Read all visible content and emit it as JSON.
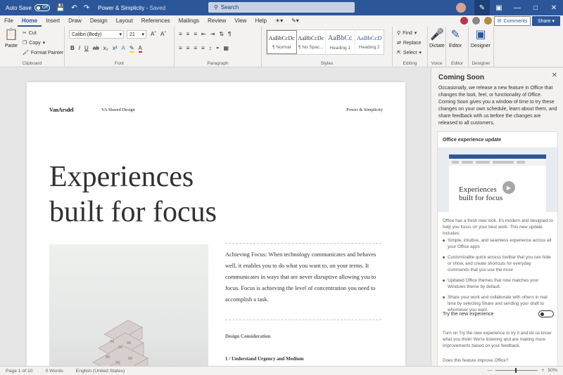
{
  "titlebar": {
    "autosave_label": "Auto Save",
    "autosave_state": "Off",
    "doc_title": "Power & Simplicity",
    "saved_status": "Saved",
    "search_placeholder": "Search"
  },
  "tabs": [
    "File",
    "Home",
    "Insert",
    "Draw",
    "Design",
    "Layout",
    "References",
    "Mailings",
    "Review",
    "View",
    "Help"
  ],
  "active_tab": "Home",
  "actions": {
    "comments": "Comments",
    "share": "Share"
  },
  "ribbon": {
    "clipboard": {
      "paste": "Paste",
      "cut": "Cut",
      "copy": "Copy",
      "format_painter": "Format Painter",
      "label": "Clipboard"
    },
    "font": {
      "family": "Calibri (Body)",
      "size": "21",
      "label": "Font"
    },
    "paragraph": {
      "label": "Paragraph"
    },
    "styles": {
      "label": "Styles",
      "items": [
        {
          "preview": "AaBbCcDc",
          "name": "¶ Normal"
        },
        {
          "preview": "AaBbCcDc",
          "name": "¶ No Spac..."
        },
        {
          "preview": "AaBbCc",
          "name": "Heading 1"
        },
        {
          "preview": "AaBbCcD",
          "name": "Heading 2"
        }
      ]
    },
    "editing": {
      "find": "Find",
      "replace": "Replace",
      "select": "Select",
      "label": "Editing"
    },
    "voice": {
      "dictate": "Dictate",
      "label": "Voice"
    },
    "editor": {
      "editor": "Editor",
      "label": "Editor"
    },
    "designer": {
      "designer": "Designer",
      "label": "Designer"
    }
  },
  "document": {
    "header_logo": "VanArsdel",
    "header_mid": "VA Shared Design",
    "header_right": "Power & Simplicity",
    "headline_line1": "Experiences",
    "headline_line2": "built for focus",
    "body": "Achieving Focus: When technology communicates and behaves well, it enables you to do what you want to, on your terms. It communicates in ways that are never disruptive allowing you to focus. Focus is achieving the level of concentration you need to accomplish a task.",
    "subheading": "Design Consideration",
    "point1": "1 / Understand Urgency and Medium"
  },
  "pane": {
    "title": "Coming Soon",
    "intro": "Occasionally, we release a new feature in Office that changes the look, feel, or functionality of Office. Coming Soon gives you a window of time to try these changes on your own schedule, learn about them, and share feedback with us before the changes are released to all customers.",
    "card_title": "Office experience update",
    "thumb_line1": "Experiences",
    "thumb_line2": "built for focus",
    "card_desc": "Office has a fresh new look. It's modern and designed to help you focus on your best work. This new update includes:",
    "bullets": [
      "Simple, intuitive, and seamless experience across all your Office apps",
      "Customizable quick access toolbar that you can hide or show, and create shortcuts for everyday commands that you use the most",
      "Updated Office themes that now matches your Windows theme by default.",
      "Share your work and collaborate with others in real time by selecting Share and sending your draft to whomever you want."
    ],
    "try_label": "Try the new experience",
    "try_desc": "Turn on Try the new experience to try it and let us know what you think! We're listening and are making more improvements based on your feedback.",
    "bottom_text": "Does this feature improve Office?"
  },
  "status": {
    "page": "Page 1 of 10",
    "words": "0 Words",
    "language": "English (United States)",
    "zoom": "50%"
  },
  "colors": {
    "brand": "#2b579a",
    "pane_bg": "#f3f2f1"
  }
}
